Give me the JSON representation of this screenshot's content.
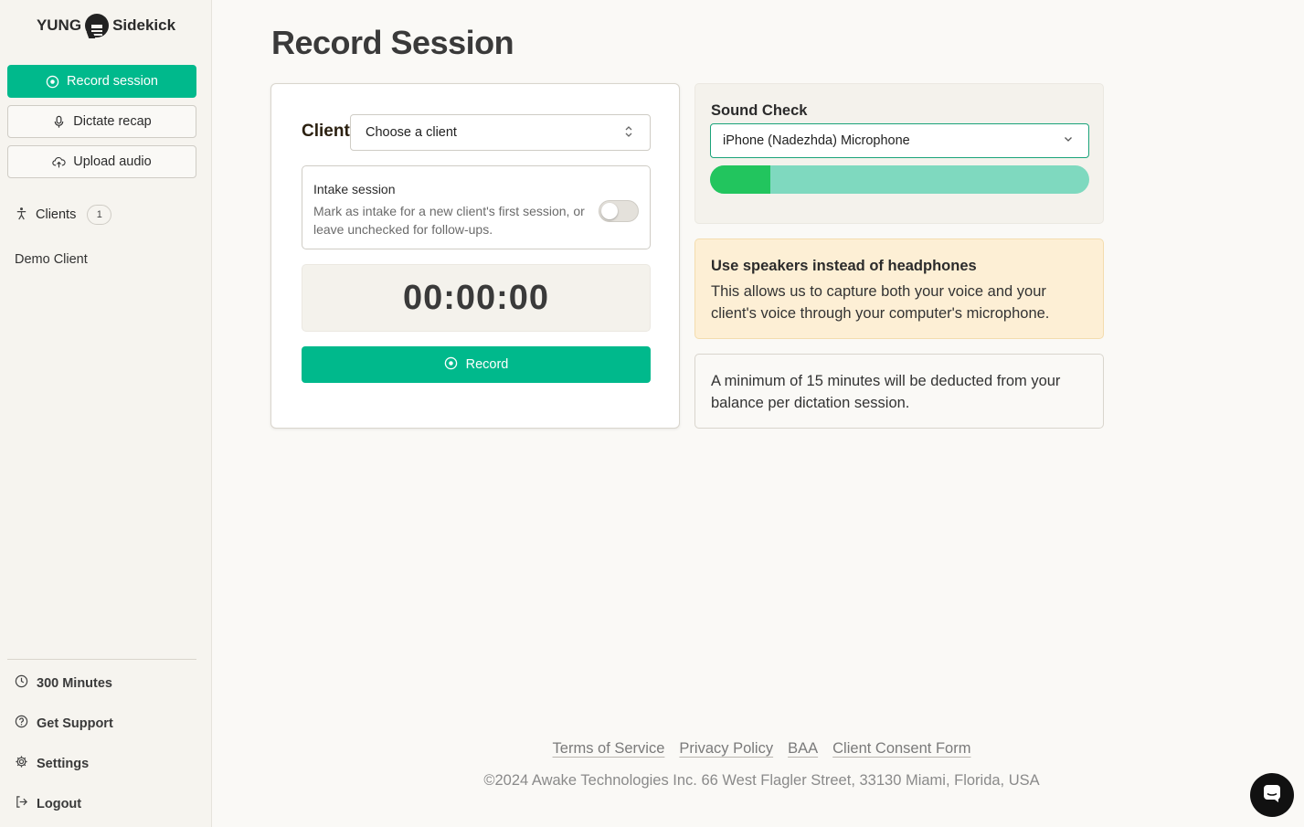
{
  "brand": {
    "left": "YUNG",
    "right": "Sidekick"
  },
  "sidebar": {
    "record_label": "Record session",
    "dictate_label": "Dictate recap",
    "upload_label": "Upload audio",
    "clients_label": "Clients",
    "clients_count": "1",
    "clients": [
      "Demo Client"
    ],
    "minutes_label": "300 Minutes",
    "support_label": "Get Support",
    "settings_label": "Settings",
    "logout_label": "Logout"
  },
  "main": {
    "title": "Record Session",
    "client_label": "Client",
    "client_select_value": "Choose a client",
    "intake_title": "Intake session",
    "intake_desc": "Mark as intake for a new client's first session, or leave unchecked for follow-ups.",
    "intake_checked": false,
    "timer": "00:00:00",
    "record_label": "Record"
  },
  "sound_check": {
    "title": "Sound Check",
    "microphone": "iPhone (Nadezhda) Microphone",
    "level": 0.16,
    "colors": {
      "fill": "#22c55e",
      "track": "#7fd9bf"
    }
  },
  "warning": {
    "title": "Use speakers instead of headphones",
    "body": "This allows us to capture both your voice and your client's voice through your computer's microphone."
  },
  "info": {
    "body": "A minimum of 15 minutes will be deducted from your balance per dictation session."
  },
  "footer": {
    "links": [
      "Terms of Service",
      "Privacy Policy",
      "BAA",
      "Client Consent Form"
    ],
    "copyright": "©2024 Awake Technologies Inc. 66 West Flagler Street, 33130 Miami, Florida, USA"
  },
  "colors": {
    "accent": "#00b98c",
    "warning_bg": "#fdefd5"
  },
  "icons": {
    "logo": "chat-bubble-icon",
    "record": "record-circle-icon",
    "dictate": "microphone-icon",
    "upload": "cloud-upload-icon",
    "clients": "person-icon",
    "minutes": "clock-icon",
    "support": "help-circle-icon",
    "settings": "gear-icon",
    "logout": "logout-icon",
    "chat": "chat-launcher-icon"
  }
}
